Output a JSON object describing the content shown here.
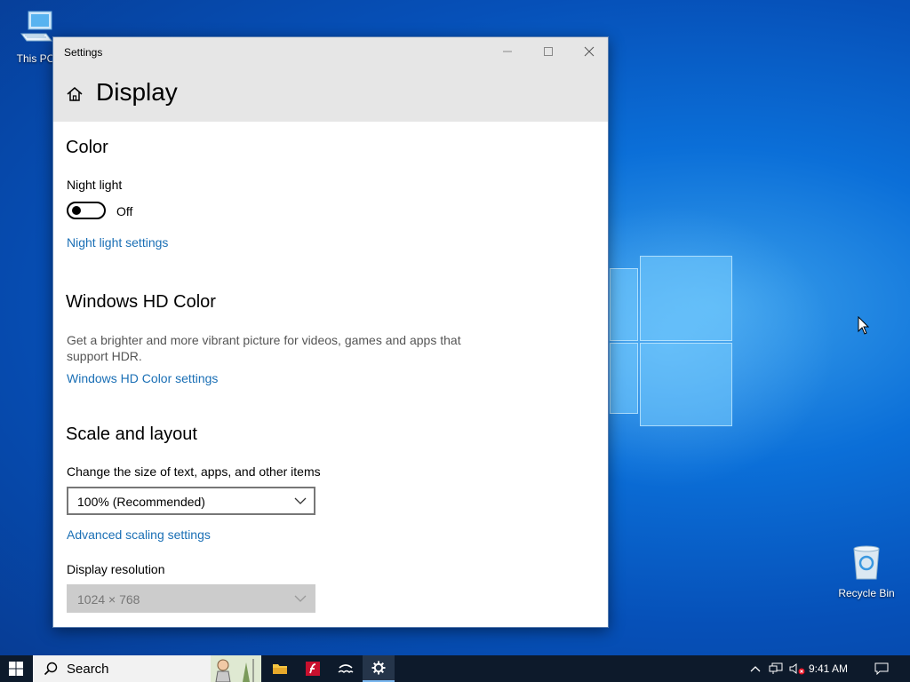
{
  "desktop": {
    "icons": [
      {
        "label": "This PC"
      },
      {
        "label": "Recycle Bin"
      }
    ]
  },
  "window": {
    "title": "Settings",
    "page_title": "Display",
    "sections": {
      "color": {
        "heading": "Color",
        "night_light_label": "Night light",
        "night_light_state": "Off",
        "night_light_link": "Night light settings"
      },
      "hd_color": {
        "heading": "Windows HD Color",
        "description": "Get a brighter and more vibrant picture for videos, games and apps that support HDR.",
        "link": "Windows HD Color settings"
      },
      "scale": {
        "heading": "Scale and layout",
        "size_label": "Change the size of text, apps, and other items",
        "size_value": "100% (Recommended)",
        "advanced_link": "Advanced scaling settings",
        "resolution_label": "Display resolution",
        "resolution_value": "1024 × 768"
      }
    }
  },
  "taskbar": {
    "search_placeholder": "Search",
    "time": "9:41 AM"
  },
  "colors": {
    "link": "#1a6fb5",
    "taskbar": "#0d1a2b",
    "titlebar": "#e6e6e6"
  }
}
